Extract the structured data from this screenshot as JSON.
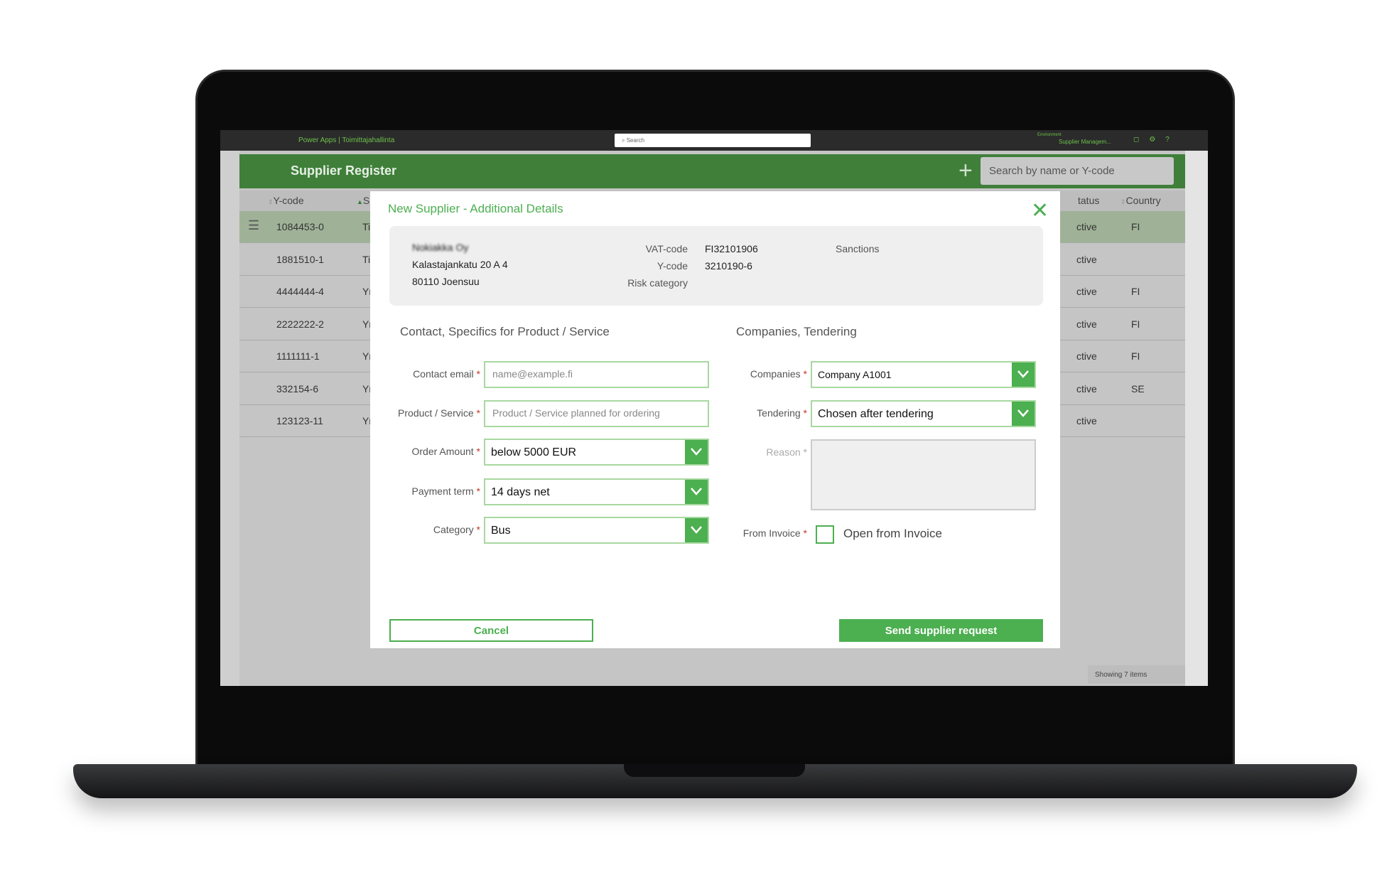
{
  "topbar": {
    "brand": "Power Apps | Toimittajahallinta",
    "search_placeholder": "Search",
    "env_label": "Environment",
    "env_name": "Supplier Managem..."
  },
  "header": {
    "title": "Supplier Register",
    "search_placeholder": "Search by name or Y-code"
  },
  "table": {
    "columns": [
      "Y-code",
      "Su",
      "tatus",
      "Country"
    ],
    "rows": [
      {
        "ycode": "1084453-0",
        "name": "Ti",
        "status": "ctive",
        "country": "FI"
      },
      {
        "ycode": "1881510-1",
        "name": "Ti",
        "status": "ctive",
        "country": ""
      },
      {
        "ycode": "4444444-4",
        "name": "Yr",
        "status": "ctive",
        "country": "FI"
      },
      {
        "ycode": "2222222-2",
        "name": "Yr",
        "status": "ctive",
        "country": "FI"
      },
      {
        "ycode": "1111111-1",
        "name": "Yr",
        "status": "ctive",
        "country": "FI"
      },
      {
        "ycode": "332154-6",
        "name": "Yr",
        "status": "ctive",
        "country": "SE"
      },
      {
        "ycode": "123123-11",
        "name": "Yr",
        "status": "ctive",
        "country": ""
      }
    ],
    "footer": "Showing 7 items"
  },
  "modal": {
    "title": "New Supplier - Additional Details",
    "supplier": {
      "name": "Nokiakka Oy",
      "street": "Kalastajankatu 20 A 4",
      "city": "80110 Joensuu",
      "vat_label": "VAT-code",
      "vat": "FI32101906",
      "ycode_label": "Y-code",
      "ycode": "3210190-6",
      "risk_label": "Risk category",
      "sanctions_label": "Sanctions"
    },
    "left_section": "Contact, Specifics for Product / Service",
    "right_section": "Companies, Tendering",
    "fields": {
      "email": {
        "label": "Contact email",
        "placeholder": "name@example.fi"
      },
      "product": {
        "label": "Product / Service",
        "placeholder": "Product / Service planned for ordering"
      },
      "amount": {
        "label": "Order Amount",
        "value": "below 5000 EUR"
      },
      "payment": {
        "label": "Payment term",
        "value": "14 days net"
      },
      "category": {
        "label": "Category",
        "value": "Bus"
      },
      "companies": {
        "label": "Companies",
        "value": "Company A1001"
      },
      "tendering": {
        "label": "Tendering",
        "value": "Chosen after tendering"
      },
      "reason": {
        "label": "Reason"
      },
      "invoice": {
        "label": "From Invoice",
        "checkbox_label": "Open from Invoice",
        "checked": false
      }
    },
    "required_mark": "*",
    "cancel": "Cancel",
    "send": "Send supplier request"
  },
  "colors": {
    "accent": "#4caf50",
    "header": "#3f7f3a"
  }
}
